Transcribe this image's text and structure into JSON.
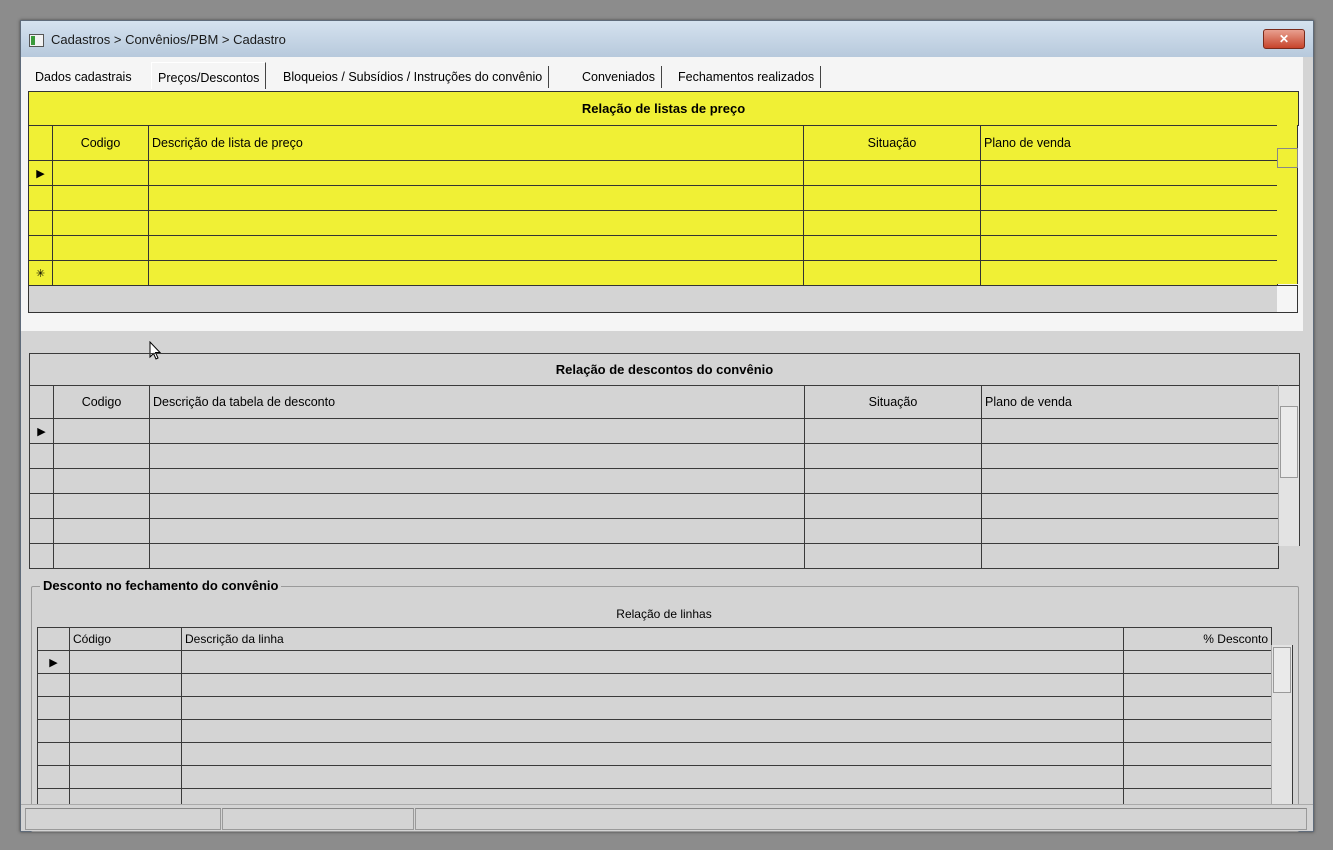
{
  "window": {
    "title": "Cadastros > Convênios/PBM > Cadastro",
    "close_label": "✕"
  },
  "tabs": [
    {
      "label": "Dados cadastrais"
    },
    {
      "label": "Preços/Descontos",
      "active": true
    },
    {
      "label": "Bloqueios / Subsídios / Instruções do convênio"
    },
    {
      "label": "Conveniados"
    },
    {
      "label": "Fechamentos realizados"
    }
  ],
  "price_lists": {
    "title": "Relação de listas de preço",
    "columns": {
      "code": "Codigo",
      "description": "Descrição de lista de preço",
      "status": "Situação",
      "plan": "Plano de venda"
    },
    "current_row_marker": "▶",
    "new_row_marker": "✳"
  },
  "discounts": {
    "title": "Relação de descontos do convênio",
    "columns": {
      "code": "Codigo",
      "description": "Descrição da tabela de desconto",
      "status": "Situação",
      "plan": "Plano de venda"
    },
    "current_row_marker": "▶"
  },
  "closing_discount": {
    "group_title": "Desconto no fechamento do convênio",
    "grid_title": "Relação de linhas",
    "columns": {
      "code": "Código",
      "description": "Descrição da linha",
      "percent": "% Desconto"
    },
    "current_row_marker": "▶"
  },
  "colors": {
    "highlight_yellow": "#f0f035",
    "panel_gray": "#d4d4d4"
  }
}
